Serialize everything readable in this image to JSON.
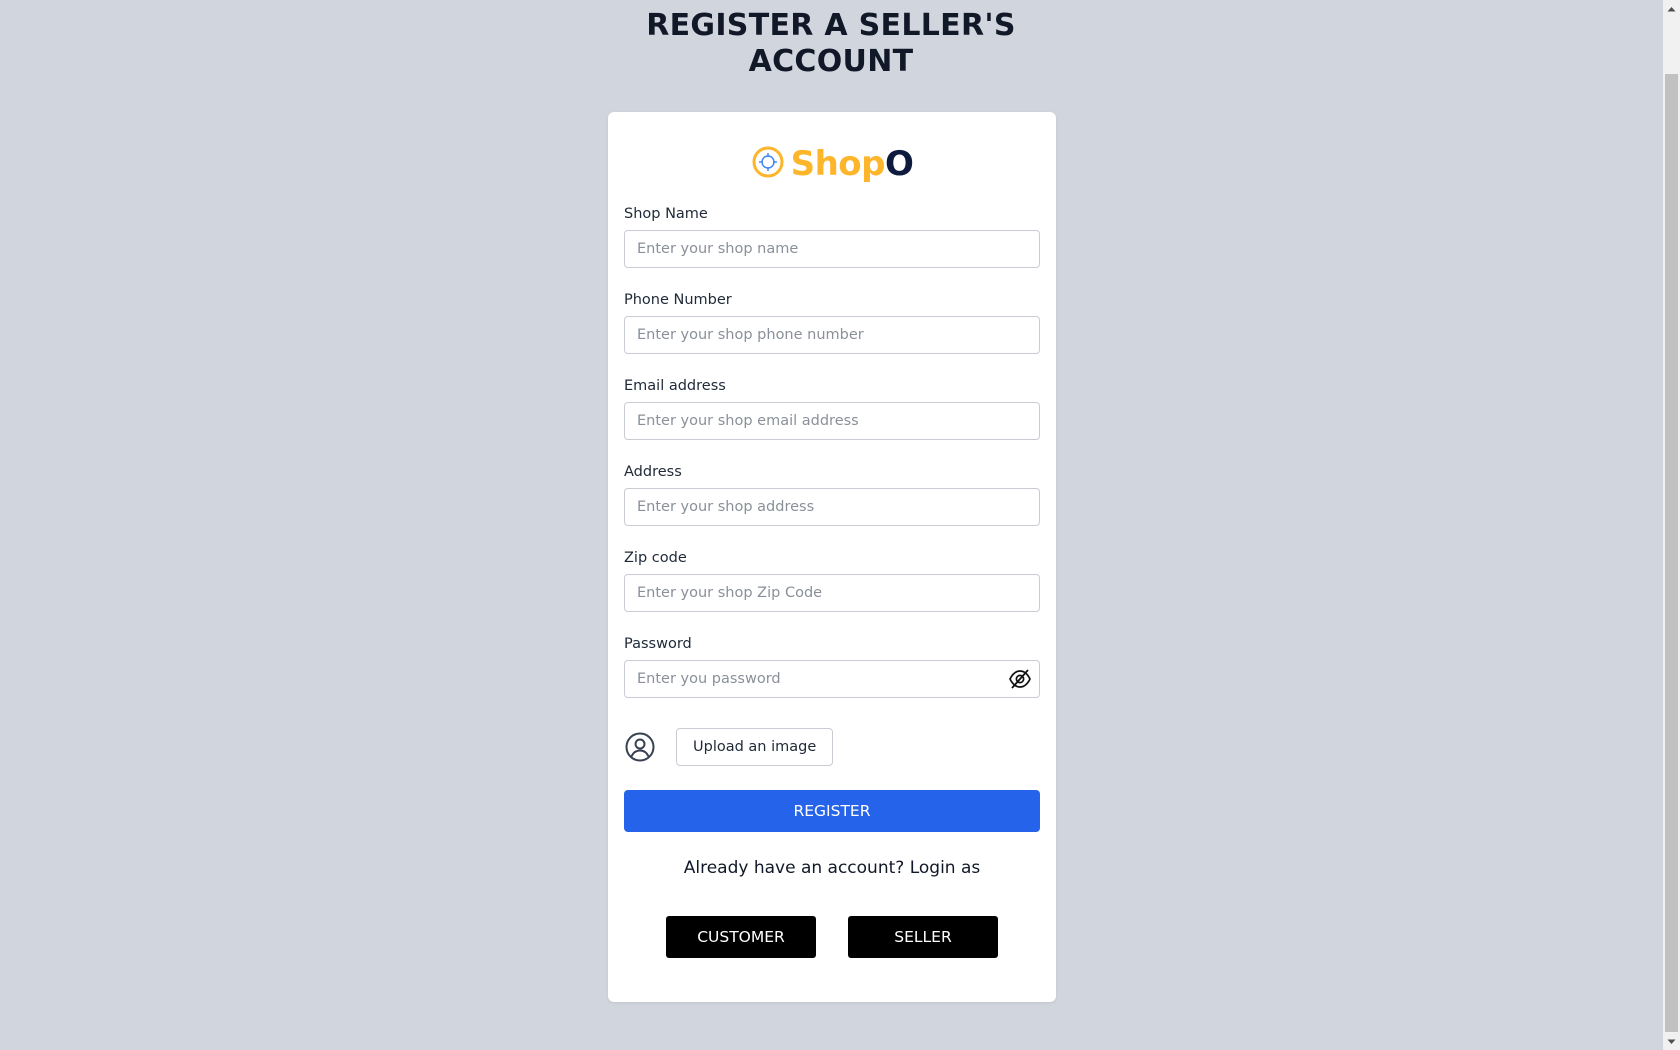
{
  "page": {
    "title_line1": "REGISTER A SELLER'S",
    "title_line2": "ACCOUNT"
  },
  "logo": {
    "text_main": "Shop",
    "text_accent": "O",
    "colors": {
      "primary": "#fdb52b",
      "accent": "#0f1b3d"
    }
  },
  "form": {
    "shop_name": {
      "label": "Shop Name",
      "placeholder": "Enter your shop name",
      "value": ""
    },
    "phone_number": {
      "label": "Phone Number",
      "placeholder": "Enter your shop phone number",
      "value": ""
    },
    "email": {
      "label": "Email address",
      "placeholder": "Enter your shop email address",
      "value": ""
    },
    "address": {
      "label": "Address",
      "placeholder": "Enter your shop address",
      "value": ""
    },
    "zip_code": {
      "label": "Zip code",
      "placeholder": "Enter your shop Zip Code",
      "value": ""
    },
    "password": {
      "label": "Password",
      "placeholder": "Enter you password",
      "value": "",
      "toggle_icon": "eye-slash-icon"
    },
    "avatar_icon": "user-circle-icon",
    "upload_label": "Upload an image",
    "register_label": "REGISTER",
    "register_color": "#2563eb"
  },
  "login": {
    "prompt": "Already have an account? Login as",
    "customer_label": "CUSTOMER",
    "seller_label": "SELLER"
  }
}
